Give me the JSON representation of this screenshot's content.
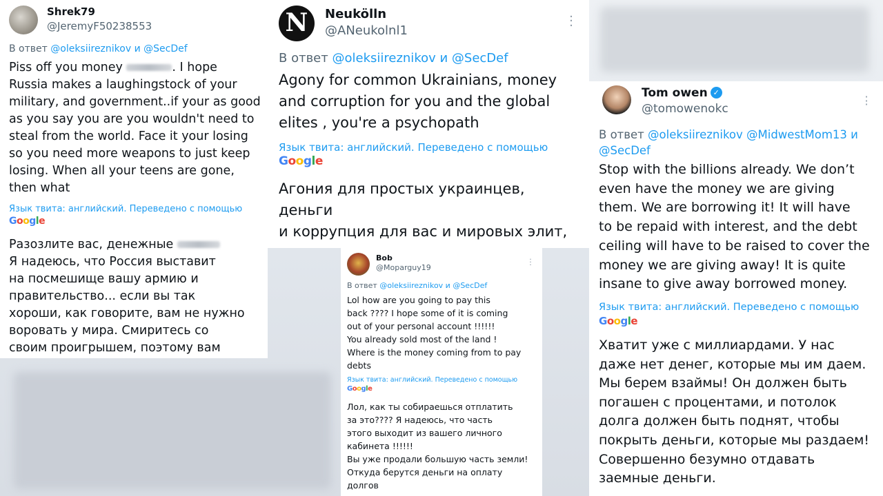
{
  "tweets": [
    {
      "name": "Shrek79",
      "handle": "@JeremyF50238553",
      "reply_prefix": "В ответ",
      "reply_mentions": "@oleksiireznikov и @SecDef",
      "text_a": "Piss off you money",
      "text_b": ". I hope\nRussia makes a laughingstock of your\nmilitary, and government..if your as good\nas you say you are you wouldn't need to\nsteal from the world. Face it your losing\nso you need more weapons to just keep\nlosing. When all your teens are gone,\nthen what",
      "translation_note": "Язык твита: английский. Переведено с помощью",
      "translated_a": "Разозлите вас, денежные",
      "translated_b": "Я надеюсь, что Россия выставит\nна посмешище вашу армию и\nправительство... если вы так\nхороши, как говорите, вам не нужно\nворовать у мира. Смиритесь со\nсвоим проигрышем, поэтому вам"
    },
    {
      "name": "Neukölln",
      "handle": "@ANeukolnl1",
      "reply_prefix": "В ответ",
      "reply_mentions": "@oleksiireznikov и @SecDef",
      "text": "Agony for common Ukrainians, money\nand corruption for you and the global\nelites , you're a psychopath",
      "translation_note": "Язык твита: английский. Переведено с помощью",
      "translated": "Агония для простых украинцев, деньги\nи коррупция для вас и мировых элит,\nвы психопат"
    },
    {
      "name": "Bob",
      "handle": "@Moparguy19",
      "reply_prefix": "В ответ",
      "reply_mentions": "@oleksiireznikov и @SecDef",
      "text": "Lol how are you going to pay this\nback ????  I hope some of it is coming\nout of your personal account  !!!!!!\nYou already sold most of the land !\nWhere is the money coming from to pay\ndebts",
      "translation_note": "Язык твита: английский. Переведено с помощью",
      "translated": "Лол, как ты собираешься отплатить\nза это???? Я надеюсь, что часть\nэтого выходит из вашего личного\nкабинета !!!!!!\nВы уже продали большую часть земли!\nОткуда берутся деньги на оплату\nдолгов"
    },
    {
      "name": "Tom owen",
      "handle": "@tomowenokc",
      "reply_prefix": "В ответ",
      "reply_mentions": "@oleksiireznikov @MidwestMom13 и\n@SecDef",
      "text": "Stop with the billions already.   We don’t\neven have the money we are giving\nthem. We are borrowing it!    It will have\nto be repaid with interest, and the debt\nceiling will have to be raised to cover the\nmoney we are giving away!    It is quite\ninsane to give away borrowed money.",
      "translation_note": "Язык твита: английский. Переведено с помощью",
      "translated": "Хватит уже с миллиардами. У нас\nдаже нет денег, которые мы им даем.\nМы берем взаймы! Он должен быть\nпогашен с процентами, и потолок\nдолга должен быть поднят, чтобы\nпокрыть деньги, которые мы раздаем!\nСовершенно безумно отдавать\nзаемные деньги."
    }
  ],
  "google_logo": {
    "g": "G",
    "o1": "o",
    "o2": "o",
    "g2": "g",
    "l": "l",
    "e": "e"
  },
  "neukolln_logo_letter": "N"
}
